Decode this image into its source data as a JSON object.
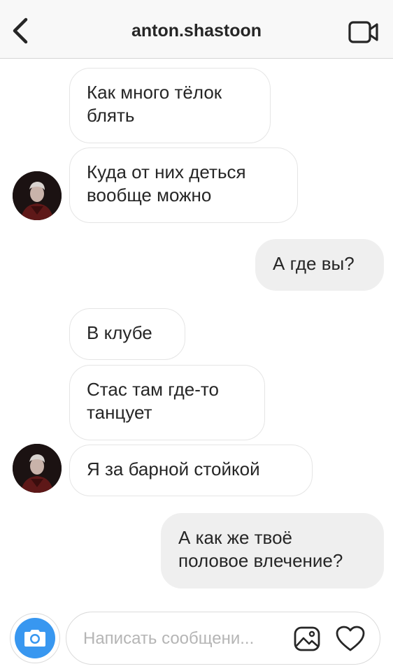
{
  "header": {
    "title": "anton.shastoon",
    "back_icon": "chevron-left-icon",
    "video_icon": "video-camera-icon"
  },
  "messages": [
    {
      "direction": "in",
      "text": "Как много тёлок\nблять"
    },
    {
      "direction": "in",
      "text": "Куда от них деться\nвообще можно"
    },
    {
      "direction": "out",
      "text": "А где вы?"
    },
    {
      "direction": "in",
      "text": "В клубе"
    },
    {
      "direction": "in",
      "text": "Стас там где-то\nтанцует"
    },
    {
      "direction": "in",
      "text": "Я за барной стойкой"
    },
    {
      "direction": "out",
      "text": "А как же твоё\nполовое влечение?"
    }
  ],
  "composer": {
    "placeholder": "Написать сообщени...",
    "value": "",
    "camera_icon": "camera-icon",
    "gallery_icon": "image-gallery-icon",
    "like_icon": "heart-icon"
  },
  "colors": {
    "header_bg": "#f8f8f8",
    "incoming_bubble_bg": "#ffffff",
    "incoming_bubble_border": "#e5e5e5",
    "outgoing_bubble_bg": "#efefef",
    "text": "#262626",
    "camera_accent": "#3897f0",
    "placeholder": "#b5b5b5"
  }
}
